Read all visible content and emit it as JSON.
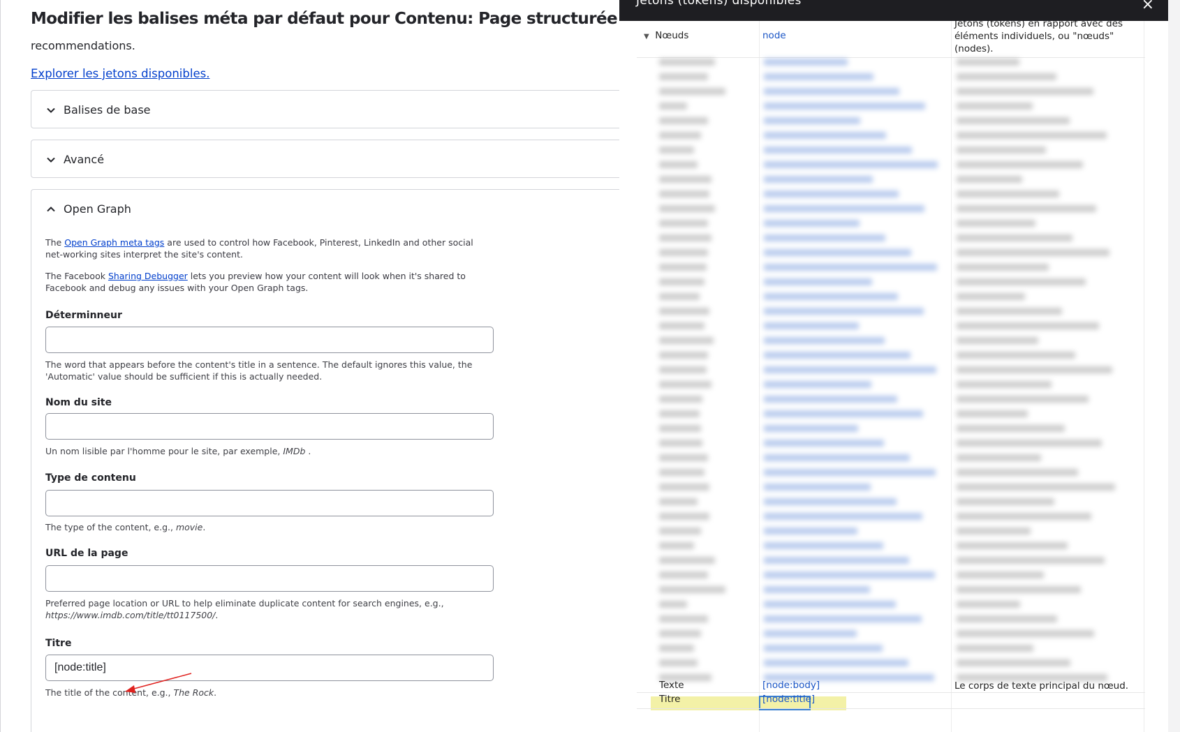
{
  "page": {
    "title": "Modifier les balises méta par défaut pour Contenu: Page structurée",
    "intro_text": "recommendations.",
    "explore_link": "Explorer les jetons disponibles."
  },
  "sections": [
    {
      "label": "Balises de base",
      "expanded": false
    },
    {
      "label": "Avancé",
      "expanded": false
    },
    {
      "label": "Open Graph",
      "expanded": true
    }
  ],
  "open_graph": {
    "desc1_prefix": "The ",
    "desc1_link": "Open Graph meta tags",
    "desc1_suffix": " are used to control how Facebook, Pinterest, LinkedIn and other social net-working sites interpret the site's content.",
    "desc2_prefix": "The Facebook ",
    "desc2_link": "Sharing Debugger",
    "desc2_suffix": " lets you preview how your content will look when it's shared to Facebook and debug any issues with your Open Graph tags.",
    "fields": [
      {
        "label": "Déterminneur",
        "value": "",
        "help": "The word that appears before the content's title in a sentence. The default ignores this value, the 'Automatic' value should be sufficient if this is actually needed.",
        "help_em": ""
      },
      {
        "label": "Nom du site",
        "value": "",
        "help": "Un nom lisible par l'homme pour le site, par exemple, ",
        "help_em": "IMDb",
        "help_tail": " ."
      },
      {
        "label": "Type de contenu",
        "value": "",
        "help": "The type of the content, e.g., ",
        "help_em": "movie",
        "help_tail": "."
      },
      {
        "label": "URL de la page",
        "value": "",
        "help": "Preferred page location or URL to help eliminate duplicate content for search engines, e.g., ",
        "help_em": "https://www.imdb.com/title/tt0117500/",
        "help_tail": "."
      },
      {
        "label": "Titre",
        "value": "[node:title]",
        "help": "The title of the content, e.g., ",
        "help_em": "The Rock",
        "help_tail": "."
      }
    ]
  },
  "dialog": {
    "title": "Jetons (tokens) disponibles",
    "close_icon": "×",
    "header_row": {
      "name": "Nœuds",
      "token": "node",
      "description": "Jetons (tokens) en rapport avec des éléments individuels, ou \"nœuds\" (nodes)."
    },
    "rows": [
      {
        "name": "Texte",
        "token": "[node:body]",
        "description": "Le corps de texte principal du nœud."
      },
      {
        "name": "Titre",
        "token": "[node:title]",
        "description": ""
      }
    ]
  },
  "colors": {
    "link": "#003ecc",
    "token_link": "#1a55c6",
    "highlight": "#f3f1a7",
    "arrow": "#e0221f"
  }
}
